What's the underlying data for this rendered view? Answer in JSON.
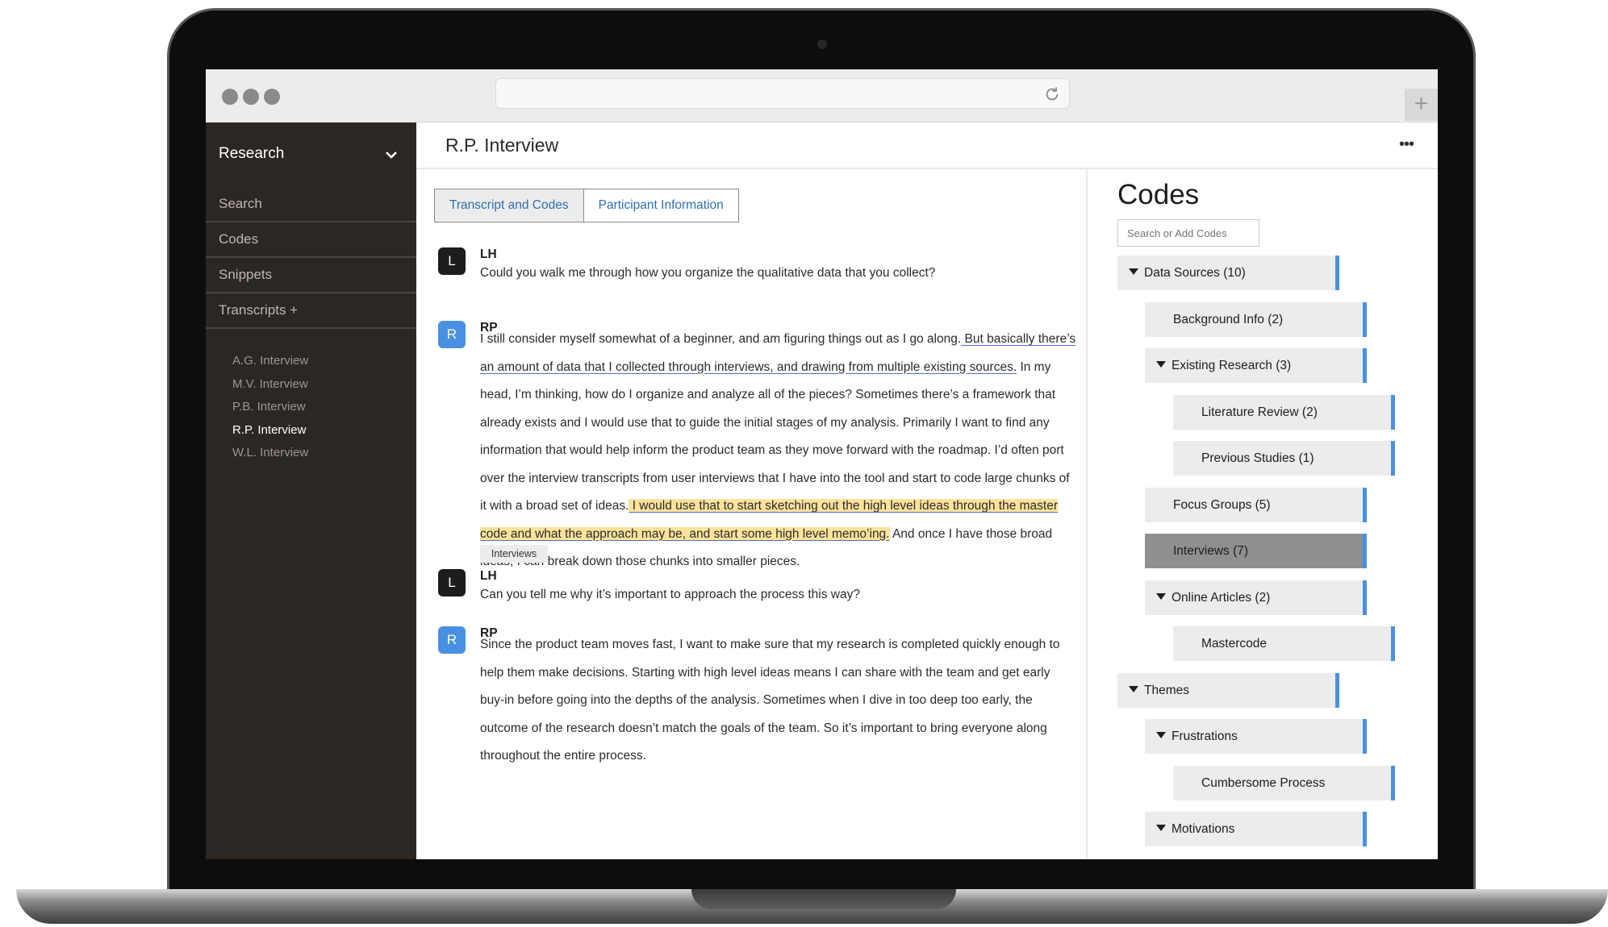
{
  "browser": {
    "new_tab_label": "+"
  },
  "sidebar": {
    "title": "Research",
    "items": [
      {
        "label": "Search"
      },
      {
        "label": "Codes"
      },
      {
        "label": "Snippets"
      },
      {
        "label": "Transcripts +"
      }
    ],
    "transcripts": [
      {
        "label": "A.G. Interview"
      },
      {
        "label": "M.V. Interview"
      },
      {
        "label": "P.B. Interview"
      },
      {
        "label": "R.P. Interview"
      },
      {
        "label": "W.L. Interview"
      }
    ]
  },
  "main": {
    "title": "R.P. Interview",
    "more_label": "•••",
    "tabs": [
      {
        "label": "Transcript and Codes"
      },
      {
        "label": "Participant Information"
      }
    ]
  },
  "messages": [
    {
      "avatar": "L",
      "speaker": "LH",
      "text": "Could you walk me through how you organize the qualitative data that you collect?"
    },
    {
      "avatar": "R",
      "speaker": "RP",
      "segments": [
        "I still consider myself somewhat of a beginner, and am figuring things out as I go along.",
        " But basically there’s an amount of data that I collected through interviews, and drawing from multiple existing sources.",
        " In my head, I’m thinking, how do I organize and analyze all of the pieces? Sometimes there’s a framework that already exists and I would use that to guide the initial stages of my analysis. Primarily I want to find any information that would help inform the product team as they move forward with the roadmap. I’d often port over the interview transcripts from user interviews that I have into the tool and start to code large chunks of it with a broad set of ideas.",
        " I would use that to start sketching out the high level ideas through the master code and what the approach may be, and start some high level memo’ing.",
        " And once I have those broad ideas, I can break down those chunks into smaller pieces."
      ],
      "tag": "Interviews"
    },
    {
      "avatar": "L",
      "speaker": "LH",
      "text": "Can you tell me why it’s important to approach the process this way?"
    },
    {
      "avatar": "R",
      "speaker": "RP",
      "text": "Since the product team moves fast, I want to make sure that my research is completed quickly enough to help them make decisions. Starting with high level ideas means I can share with the team and get early buy-in before going into the depths of the analysis. Sometimes when I dive in too deep too early, the outcome of the research doesn’t match the goals of the team. So it’s important to bring everyone along throughout the entire process."
    }
  ],
  "codes": {
    "title": "Codes",
    "search_placeholder": "Search or Add Codes",
    "items": [
      {
        "label": "Data Sources (10)",
        "level": 0,
        "expanded": true
      },
      {
        "label": "Background Info (2)",
        "level": 1
      },
      {
        "label": "Existing Research (3)",
        "level": 1,
        "expanded": true
      },
      {
        "label": "Literature Review (2)",
        "level": 2
      },
      {
        "label": "Previous Studies (1)",
        "level": 2
      },
      {
        "label": "Focus Groups (5)",
        "level": 1
      },
      {
        "label": "Interviews (7)",
        "level": 1,
        "selected": true
      },
      {
        "label": "Online Articles (2)",
        "level": 1,
        "expanded": true
      },
      {
        "label": "Mastercode",
        "level": 2
      },
      {
        "label": "Themes",
        "level": 0,
        "expanded": true
      },
      {
        "label": "Frustrations",
        "level": 1,
        "expanded": true
      },
      {
        "label": "Cumbersome Process",
        "level": 2
      },
      {
        "label": "Motivations",
        "level": 1,
        "expanded": true
      }
    ]
  },
  "colors": {
    "sidebar_bg": "#2d2724",
    "accent_blue": "#4a90e2",
    "highlight_yellow": "#fce29b",
    "selected_code": "#8f8f8f"
  }
}
